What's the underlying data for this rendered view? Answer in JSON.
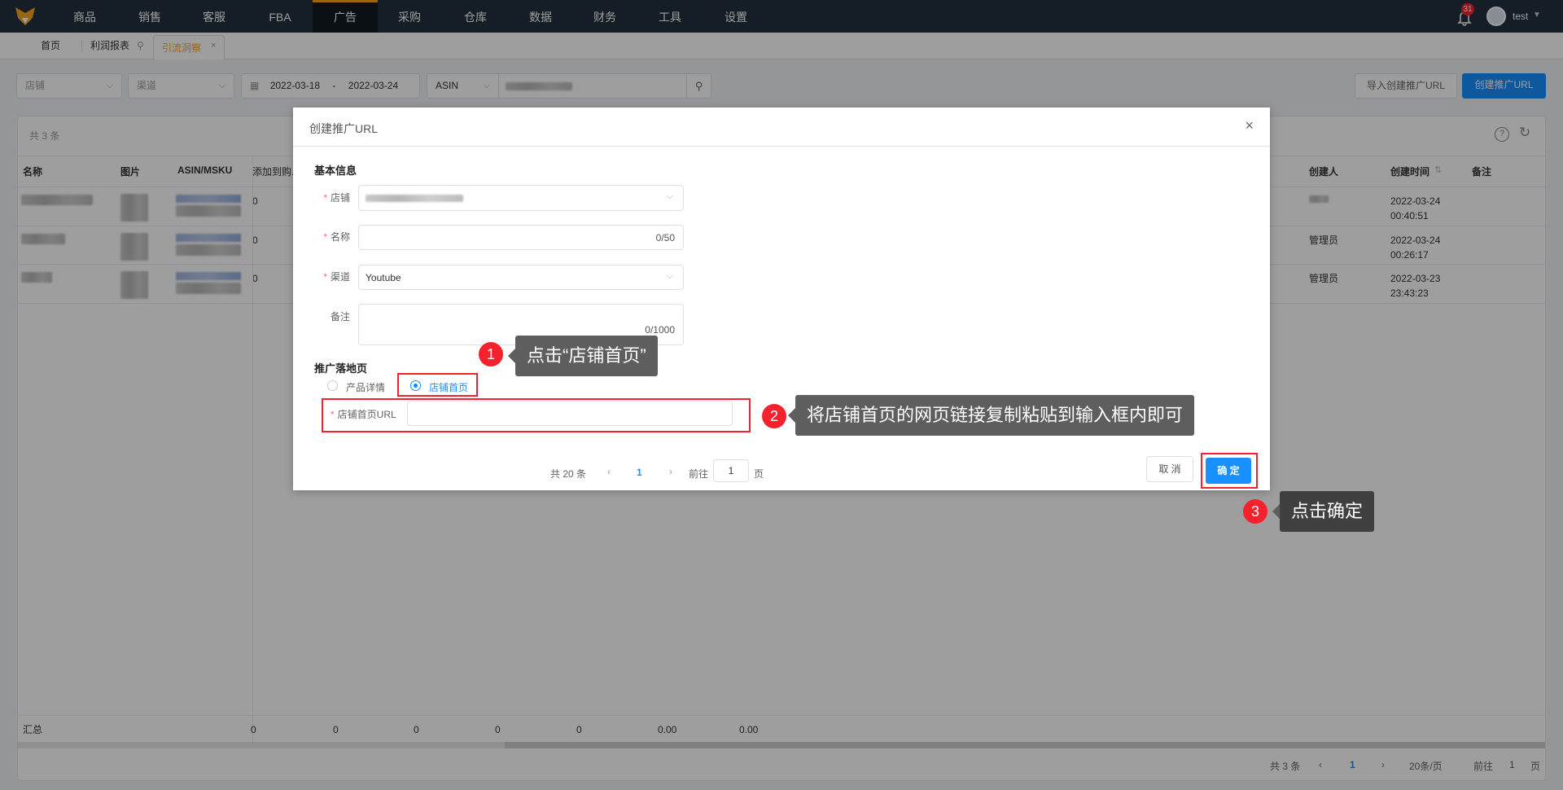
{
  "nav": {
    "items": [
      "商品",
      "销售",
      "客服",
      "FBA",
      "广告",
      "采购",
      "仓库",
      "数据",
      "财务",
      "工具",
      "设置"
    ],
    "active": "广告",
    "notification_count": "31",
    "user": "test"
  },
  "tabs": [
    {
      "label": "首页"
    },
    {
      "label": "利润报表"
    },
    {
      "label": "引流洞察"
    }
  ],
  "filters": {
    "store_placeholder": "店铺",
    "channel_placeholder": "渠道",
    "date_start": "2022-03-18",
    "date_sep": "-",
    "date_end": "2022-03-24",
    "search_type": "ASIN"
  },
  "actions": {
    "import": "导入创建推广URL",
    "create": "创建推广URL"
  },
  "table": {
    "count": "共 3 条",
    "headers": [
      "名称",
      "图片",
      "ASIN/MSKU",
      "添加到购...",
      "创建人",
      "创建时间",
      "备注"
    ],
    "rows": [
      {
        "add": "0",
        "creator": "",
        "date": "2022-03-24",
        "time": "00:40:51"
      },
      {
        "add": "0",
        "creator": "管理员",
        "date": "2022-03-24",
        "time": "00:26:17"
      },
      {
        "add": "0",
        "creator": "管理员",
        "date": "2022-03-23",
        "time": "23:43:23"
      }
    ],
    "summary_label": "汇总",
    "summary_values": [
      "0",
      "0",
      "0",
      "0",
      "0",
      "0.00",
      "0.00"
    ],
    "pagination": {
      "total": "共 3 条",
      "page": "1",
      "size": "20条/页",
      "goto": "前往",
      "goto_value": "1",
      "suffix": "页"
    }
  },
  "modal": {
    "title": "创建推广URL",
    "section_basic": "基本信息",
    "store_label": "店铺",
    "name_label": "名称",
    "name_count": "0/50",
    "channel_label": "渠道",
    "channel_value": "Youtube",
    "remark_label": "备注",
    "remark_count": "0/1000",
    "section_landing": "推广落地页",
    "radio_product": "产品详情",
    "radio_store": "店铺首页",
    "url_label": "店铺首页URL",
    "pagination": {
      "total": "共 20 条",
      "page": "1",
      "goto": "前往",
      "goto_value": "1",
      "suffix": "页"
    },
    "cancel": "取 消",
    "confirm": "确 定"
  },
  "callouts": [
    {
      "num": "1",
      "text": "点击“店铺首页”"
    },
    {
      "num": "2",
      "text": "将店铺首页的网页链接复制粘贴到输入框内即可"
    },
    {
      "num": "3",
      "text": "点击确定"
    }
  ],
  "colors": {
    "nav": "#232f3e",
    "accent": "#f5a623",
    "primary": "#1890ff",
    "annotation": "#f5222d"
  }
}
